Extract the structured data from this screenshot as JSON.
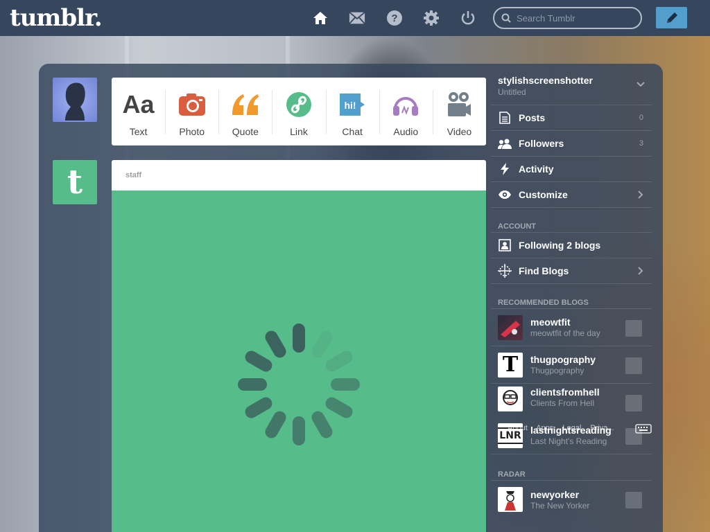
{
  "header": {
    "logo": "tumblr.",
    "search_placeholder": "Search Tumblr"
  },
  "post_types": [
    {
      "label": "Text",
      "icon": "text-icon",
      "color": "#444444"
    },
    {
      "label": "Photo",
      "icon": "camera-icon",
      "color": "#d95e40"
    },
    {
      "label": "Quote",
      "icon": "quote-icon",
      "color": "#f2992e"
    },
    {
      "label": "Link",
      "icon": "link-icon",
      "color": "#56bc8a"
    },
    {
      "label": "Chat",
      "icon": "chat-icon",
      "color": "#529ecc"
    },
    {
      "label": "Audio",
      "icon": "headphones-icon",
      "color": "#a77dc2"
    },
    {
      "label": "Video",
      "icon": "video-camera-icon",
      "color": "#748089"
    }
  ],
  "post": {
    "author": "staff",
    "body_color": "#56bc8a"
  },
  "sidebar": {
    "blog_name": "stylishscreenshotter",
    "blog_subtitle": "Untitled",
    "items": [
      {
        "label": "Posts",
        "count": "0",
        "icon": "posts-icon"
      },
      {
        "label": "Followers",
        "count": "3",
        "icon": "followers-icon"
      },
      {
        "label": "Activity",
        "count": "",
        "icon": "activity-icon"
      },
      {
        "label": "Customize",
        "count": "",
        "icon": "eye-icon"
      }
    ],
    "account_heading": "ACCOUNT",
    "account_items": [
      {
        "label": "Following 2 blogs",
        "icon": "following-icon"
      },
      {
        "label": "Find Blogs",
        "icon": "compass-icon"
      }
    ],
    "recommended_heading": "RECOMMENDED BLOGS",
    "recommended": [
      {
        "name": "meowtfit",
        "desc": "meowtfit of the day"
      },
      {
        "name": "thugpography",
        "desc": "Thugpography"
      },
      {
        "name": "clientsfromhell",
        "desc": "Clients From Hell"
      },
      {
        "name": "lastnightsreading",
        "desc": "Last Night's Reading"
      }
    ],
    "footer_links": [
      "About",
      "Apps",
      "Legal",
      "Priva..."
    ],
    "radar_heading": "RADAR",
    "radar": [
      {
        "name": "newyorker",
        "desc": "The New Yorker"
      }
    ]
  },
  "colors": {
    "nav_bg": "#36465d",
    "accent": "#529ecc",
    "staff_green": "#56bc8a"
  }
}
